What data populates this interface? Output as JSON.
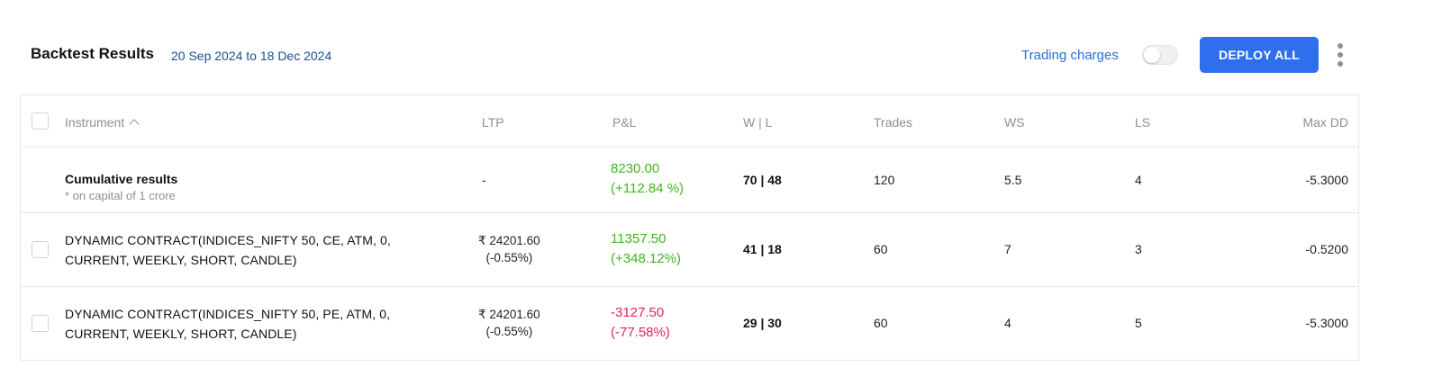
{
  "header": {
    "title": "Backtest Results",
    "date_range": "20 Sep 2024 to 18 Dec 2024",
    "trading_charges_label": "Trading charges",
    "trading_charges_on": false,
    "deploy_label": "DEPLOY ALL"
  },
  "colors": {
    "accent": "#2f6fed",
    "profit": "#3fb51e",
    "loss": "#e0245e"
  },
  "table": {
    "columns": [
      "Instrument",
      "LTP",
      "P&L",
      "W | L",
      "Trades",
      "WS",
      "LS",
      "Max DD"
    ],
    "cumulative": {
      "name": "Cumulative results",
      "note": "* on capital of 1 crore",
      "ltp": "-",
      "pnl": "8230.00",
      "pnl_pct": "(+112.84 %)",
      "wl": "70 | 48",
      "trades": "120",
      "ws": "5.5",
      "ls": "4",
      "max_dd": "-5.3000"
    },
    "rows": [
      {
        "name_line1": "DYNAMIC CONTRACT(INDICES_NIFTY 50, CE, ATM, 0,",
        "name_line2": "CURRENT, WEEKLY, SHORT, CANDLE)",
        "ltp": "₹ 24201.60",
        "ltp_change": "(-0.55%)",
        "pnl": "11357.50",
        "pnl_pct": "(+348.12%)",
        "pnl_sign": "positive",
        "wl": "41 | 18",
        "trades": "60",
        "ws": "7",
        "ls": "3",
        "max_dd": "-0.5200"
      },
      {
        "name_line1": "DYNAMIC CONTRACT(INDICES_NIFTY 50, PE, ATM, 0,",
        "name_line2": "CURRENT, WEEKLY, SHORT, CANDLE)",
        "ltp": "₹ 24201.60",
        "ltp_change": "(-0.55%)",
        "pnl": "-3127.50",
        "pnl_pct": "(-77.58%)",
        "pnl_sign": "negative",
        "wl": "29 | 30",
        "trades": "60",
        "ws": "4",
        "ls": "5",
        "max_dd": "-5.3000"
      }
    ]
  }
}
